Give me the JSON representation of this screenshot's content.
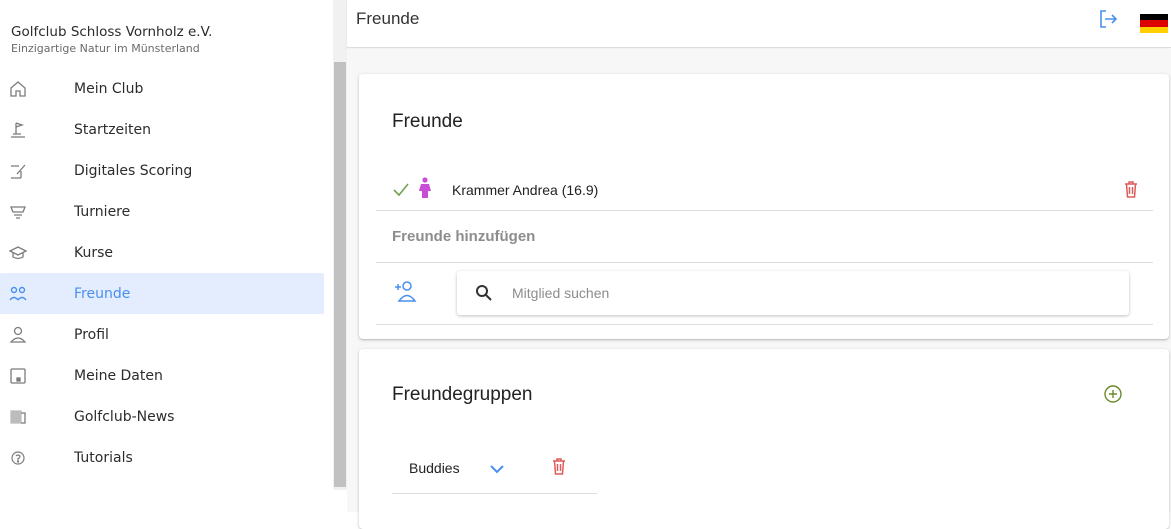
{
  "club": {
    "name": "Golfclub Schloss Vornholz e.V.",
    "subtitle": "Einzigartige Natur im Münsterland"
  },
  "sidebar": {
    "items": [
      {
        "label": "Mein Club",
        "icon": "home-icon"
      },
      {
        "label": "Startzeiten",
        "icon": "golf-tee-icon"
      },
      {
        "label": "Digitales Scoring",
        "icon": "scoring-pen-icon"
      },
      {
        "label": "Turniere",
        "icon": "trophy-icon"
      },
      {
        "label": "Kurse",
        "icon": "graduation-cap-icon"
      },
      {
        "label": "Freunde",
        "icon": "people-icon",
        "active": true
      },
      {
        "label": "Profil",
        "icon": "person-icon"
      },
      {
        "label": "Meine Daten",
        "icon": "data-icon"
      },
      {
        "label": "Golfclub-News",
        "icon": "news-icon"
      },
      {
        "label": "Tutorials",
        "icon": "help-circle-icon"
      }
    ]
  },
  "header": {
    "title": "Freunde",
    "flag": "german-flag"
  },
  "friends_card": {
    "title": "Freunde",
    "friends": [
      {
        "name": "Krammer Andrea (16.9)",
        "confirmed": true,
        "gender": "female"
      }
    ],
    "add_label": "Freunde hinzufügen",
    "search_placeholder": "Mitglied suchen"
  },
  "groups_card": {
    "title": "Freundegruppen",
    "groups": [
      {
        "name": "Buddies"
      }
    ]
  },
  "colors": {
    "accent": "#4a8ff0",
    "active_bg": "#e3edfd",
    "delete": "#e05a5a",
    "confirm": "#73a24d",
    "female": "#c84ed6",
    "add_group": "#6a8a2a"
  }
}
